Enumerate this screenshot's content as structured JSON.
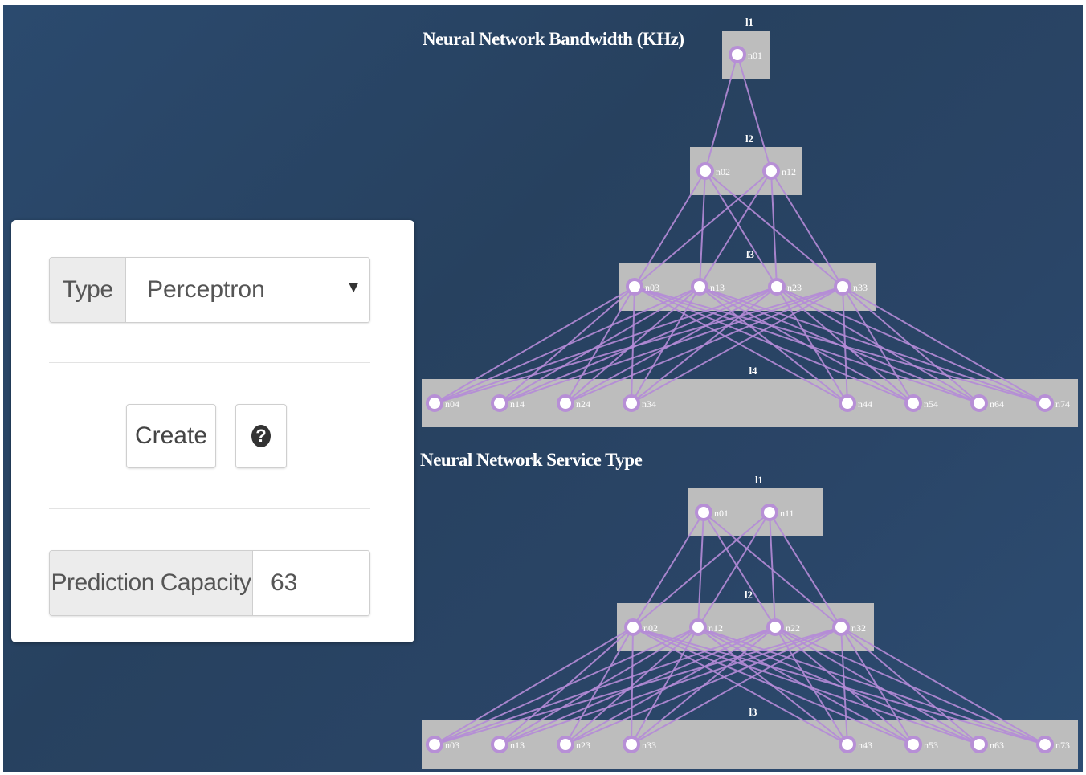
{
  "form": {
    "type_label": "Type",
    "type_value": "Perceptron",
    "create_label": "Create",
    "help_icon": "question-circle-icon",
    "capacity_label": "Prediction Capacity",
    "capacity_value": "63"
  },
  "networks": [
    {
      "title": "Neural Network Bandwidth (KHz)",
      "layers": [
        {
          "label": "l1",
          "nodes": [
            "n01"
          ]
        },
        {
          "label": "l2",
          "nodes": [
            "n02",
            "n12"
          ]
        },
        {
          "label": "l3",
          "nodes": [
            "n03",
            "n13",
            "n23",
            "n33"
          ]
        },
        {
          "label": "l4",
          "nodes": [
            "n04",
            "n14",
            "n24",
            "n34",
            "n44",
            "n54",
            "n64",
            "n74"
          ]
        }
      ]
    },
    {
      "title": "Neural Network Service Type",
      "layers": [
        {
          "label": "l1",
          "nodes": [
            "n01",
            "n11"
          ]
        },
        {
          "label": "l2",
          "nodes": [
            "n02",
            "n12",
            "n22",
            "n32"
          ]
        },
        {
          "label": "l3",
          "nodes": [
            "n03",
            "n13",
            "n23",
            "n33",
            "n43",
            "n53",
            "n63",
            "n73"
          ]
        }
      ]
    }
  ],
  "colors": {
    "background": "#2a4567",
    "layer_box": "#bdbdbd",
    "node_fill": "#ffffff",
    "node_stroke": "#b78fd6",
    "edge": "#b58bd8"
  }
}
